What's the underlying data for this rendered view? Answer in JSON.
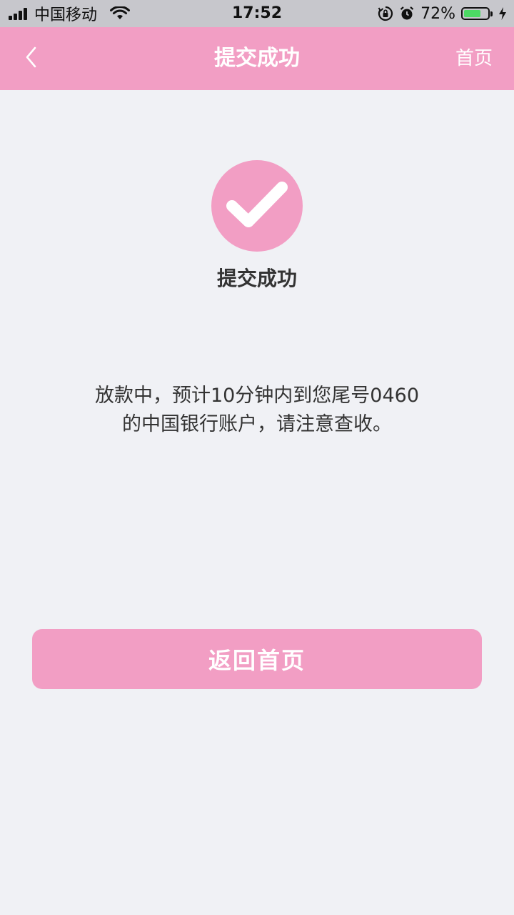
{
  "status_bar": {
    "carrier": "中国移动",
    "time": "17:52",
    "battery_text": "72%",
    "battery_level": 0.72,
    "battery_color": "#4cd964"
  },
  "nav": {
    "back_icon": "chevron-left-icon",
    "title": "提交成功",
    "home_link": "首页"
  },
  "result": {
    "icon": "check-icon",
    "title": "提交成功",
    "message_line1": "放款中，预计10分钟内到您尾号0460",
    "message_line2": "的中国银行账户，请注意查收。"
  },
  "actions": {
    "home_button": "返回首页"
  },
  "colors": {
    "accent": "#f29ec4",
    "background": "#f0f1f5",
    "text": "#333333"
  }
}
